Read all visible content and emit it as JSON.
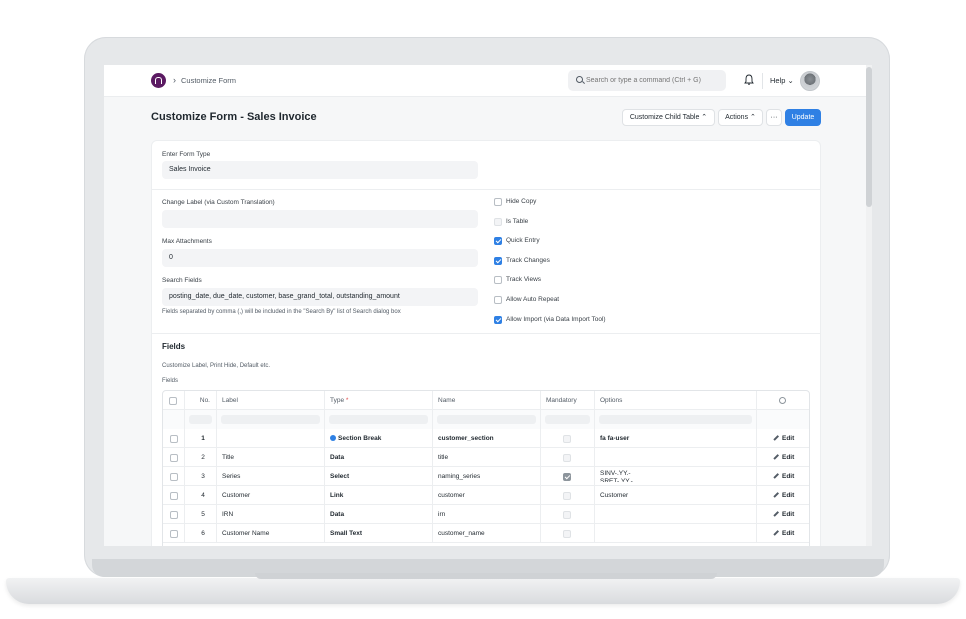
{
  "navbar": {
    "breadcrumb": "Customize Form",
    "breadcrumb_sep": "›",
    "search_placeholder": "Search or type a command (Ctrl + G)",
    "help_label": "Help",
    "help_chevron": "⌄"
  },
  "header": {
    "title": "Customize Form - Sales Invoice",
    "customize_child_table_label": "Customize Child Table ⌃",
    "actions_label": "Actions ⌃",
    "more_label": "···",
    "update_label": "Update"
  },
  "form": {
    "form_type_label": "Enter Form Type",
    "form_type_value": "Sales Invoice",
    "change_label_label": "Change Label (via Custom Translation)",
    "change_label_value": "",
    "max_attachments_label": "Max Attachments",
    "max_attachments_value": "0",
    "search_fields_label": "Search Fields",
    "search_fields_value": "posting_date, due_date, customer, base_grand_total, outstanding_amount",
    "search_fields_hint": "Fields separated by comma (,) will be included in the \"Search By\" list of Search dialog box",
    "checkboxes": [
      {
        "label": "Hide Copy",
        "checked": false,
        "disabled": false
      },
      {
        "label": "Is Table",
        "checked": false,
        "disabled": true
      },
      {
        "label": "Quick Entry",
        "checked": true,
        "disabled": false
      },
      {
        "label": "Track Changes",
        "checked": true,
        "disabled": false
      },
      {
        "label": "Track Views",
        "checked": false,
        "disabled": false
      },
      {
        "label": "Allow Auto Repeat",
        "checked": false,
        "disabled": false
      },
      {
        "label": "Allow Import (via Data Import Tool)",
        "checked": true,
        "disabled": false
      }
    ]
  },
  "fields_section": {
    "title": "Fields",
    "subtitle": "Customize Label, Print Hide, Default etc.",
    "grid_label": "Fields",
    "columns": {
      "no": "No.",
      "label": "Label",
      "type": "Type",
      "type_required": "*",
      "name": "Name",
      "mandatory": "Mandatory",
      "options": "Options"
    },
    "edit_label": "Edit",
    "rows": [
      {
        "no": "1",
        "label": "",
        "type": "Section Break",
        "name": "customer_section",
        "mandatory": false,
        "options": "fa fa-user",
        "options2": ""
      },
      {
        "no": "2",
        "label": "Title",
        "type": "Data",
        "name": "title",
        "mandatory": false,
        "options": "",
        "options2": ""
      },
      {
        "no": "3",
        "label": "Series",
        "type": "Select",
        "name": "naming_series",
        "mandatory": true,
        "options": "SINV-.YY.-",
        "options2": "SRET-.YY.-"
      },
      {
        "no": "4",
        "label": "Customer",
        "type": "Link",
        "name": "customer",
        "mandatory": false,
        "options": "Customer",
        "options2": ""
      },
      {
        "no": "5",
        "label": "IRN",
        "type": "Data",
        "name": "irn",
        "mandatory": false,
        "options": "",
        "options2": ""
      },
      {
        "no": "6",
        "label": "Customer Name",
        "type": "Small Text",
        "name": "customer_name",
        "mandatory": false,
        "options": "",
        "options2": ""
      }
    ]
  },
  "colors": {
    "primary": "#2f80e4",
    "logo": "#5b1a62"
  }
}
